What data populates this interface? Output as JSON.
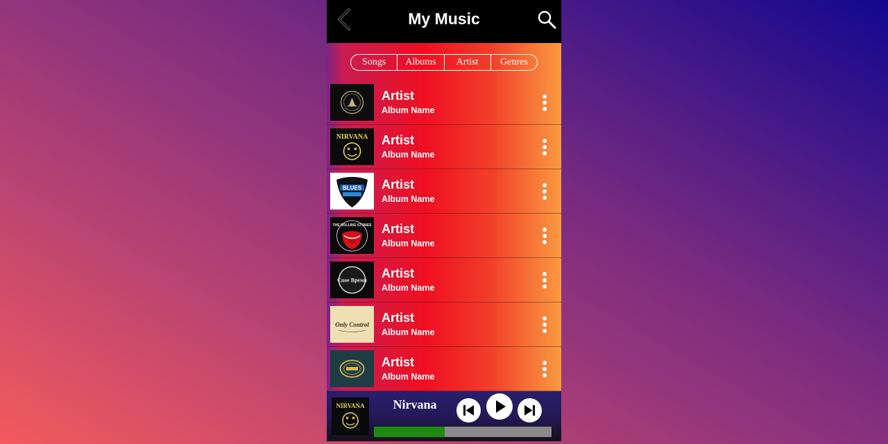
{
  "header": {
    "title": "My Music",
    "back_icon": "chevron-left-icon",
    "search_icon": "search-icon"
  },
  "tabs": [
    {
      "label": "Songs"
    },
    {
      "label": "Albums"
    },
    {
      "label": "Artist"
    },
    {
      "label": "Genres"
    }
  ],
  "list": [
    {
      "artist": "Artist",
      "album": "Album Name",
      "cover_text": ""
    },
    {
      "artist": "Artist",
      "album": "Album Name",
      "cover_text": "NIRVANA"
    },
    {
      "artist": "Artist",
      "album": "Album Name",
      "cover_text": "BLUES"
    },
    {
      "artist": "Artist",
      "album": "Album Name",
      "cover_text": "THE ROLLING STONES"
    },
    {
      "artist": "Artist",
      "album": "Album Name",
      "cover_text": "Свое Время"
    },
    {
      "artist": "Artist",
      "album": "Album Name",
      "cover_text": "Only Control"
    },
    {
      "artist": "Artist",
      "album": "Album Name",
      "cover_text": ""
    }
  ],
  "player": {
    "title": "Nirvana",
    "cover_text": "NIRVANA",
    "progress": 0.4
  },
  "colors": {
    "accent_progress": "#1f8a12",
    "progress_track": "#8a8a8a"
  }
}
